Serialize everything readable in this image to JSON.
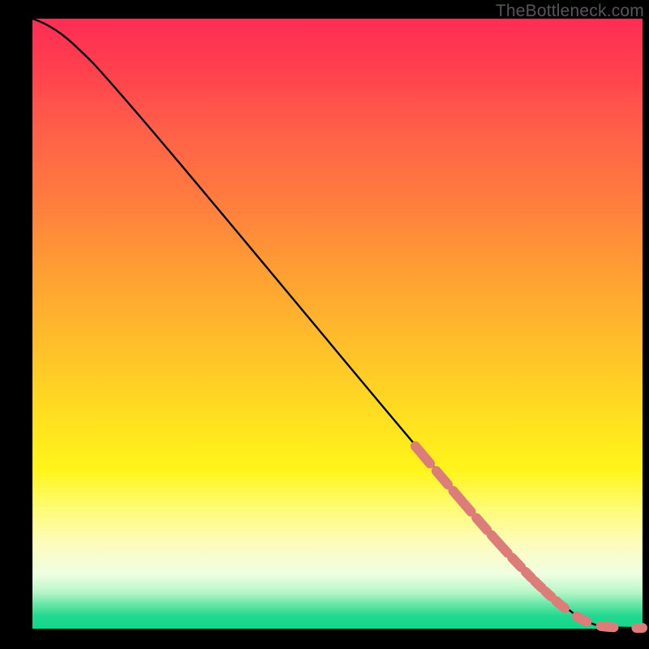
{
  "watermark": "TheBottleneck.com",
  "chart_data": {
    "type": "line",
    "title": "",
    "xlabel": "",
    "ylabel": "",
    "xlim": [
      0,
      100
    ],
    "ylim": [
      0,
      100
    ],
    "series": [
      {
        "name": "curve",
        "color": "#000000",
        "x": [
          0,
          3,
          6,
          10,
          15,
          20,
          25,
          30,
          35,
          40,
          45,
          50,
          55,
          60,
          63,
          66,
          69,
          72,
          74,
          76,
          78,
          80,
          82,
          84,
          85,
          87,
          89,
          91,
          92,
          94,
          96,
          98,
          100
        ],
        "y": [
          100,
          99,
          97,
          94,
          89,
          83,
          77,
          71,
          65,
          59,
          53,
          46,
          40,
          34,
          30,
          27,
          23,
          20,
          17,
          15,
          13,
          11,
          9,
          7,
          6,
          4,
          3,
          2,
          1.2,
          0.6,
          0.2,
          0.1,
          0.1
        ]
      },
      {
        "name": "highlighted-segment",
        "color": "#dd7d79",
        "style": "dashed-thick",
        "x": [
          63,
          66,
          69,
          72,
          74,
          76,
          78,
          80,
          82,
          84,
          85,
          87,
          89,
          91,
          92,
          94,
          96,
          98,
          100
        ],
        "y": [
          30,
          27,
          23,
          20,
          17,
          15,
          13,
          11,
          9,
          7,
          6,
          4,
          3,
          2,
          1.2,
          0.6,
          0.2,
          0.1,
          0.1
        ]
      }
    ],
    "gradient_stops": [
      {
        "pos": 0,
        "color": "#ff2d55"
      },
      {
        "pos": 0.3,
        "color": "#ff7d3e"
      },
      {
        "pos": 0.55,
        "color": "#ffc329"
      },
      {
        "pos": 0.74,
        "color": "#fff51a"
      },
      {
        "pos": 0.86,
        "color": "#fdfcbc"
      },
      {
        "pos": 0.96,
        "color": "#56e39f"
      },
      {
        "pos": 1.0,
        "color": "#14d68b"
      }
    ]
  }
}
